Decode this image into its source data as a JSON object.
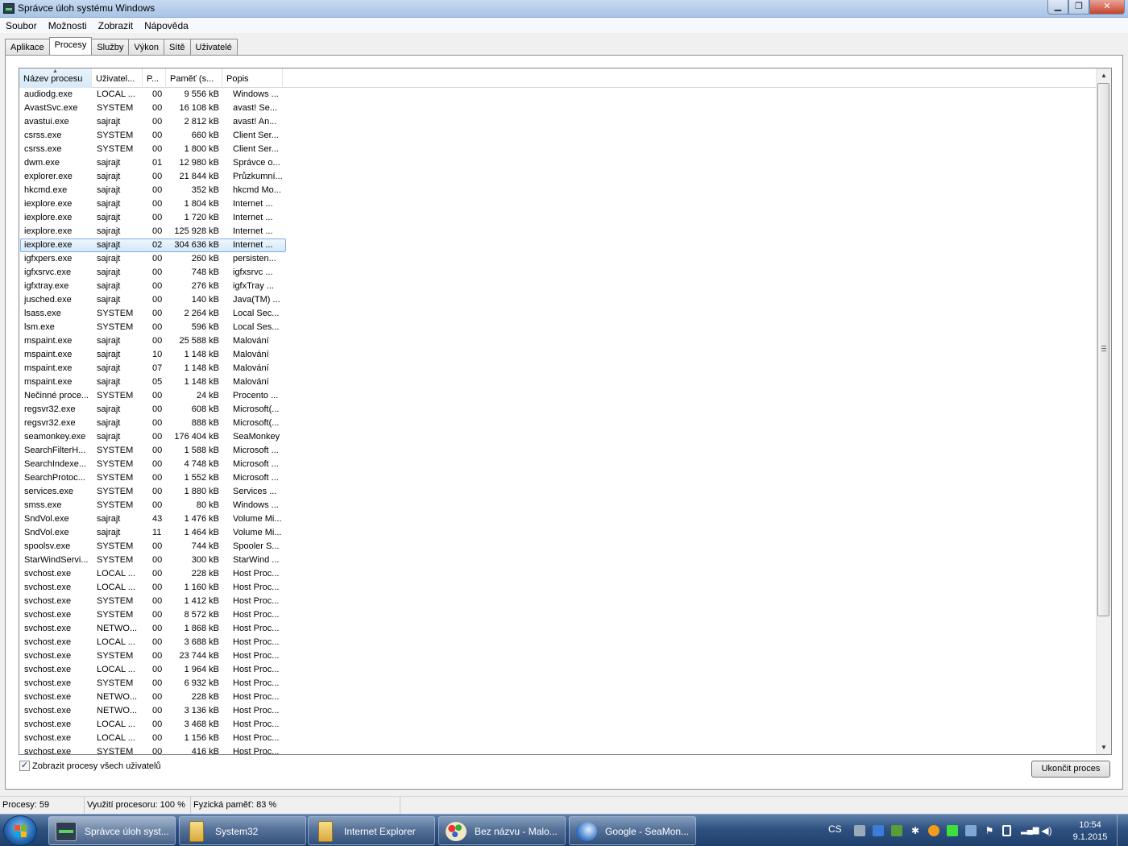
{
  "window": {
    "title": "Správce úloh systému Windows"
  },
  "menu": [
    "Soubor",
    "Možnosti",
    "Zobrazit",
    "Nápověda"
  ],
  "tabs": [
    "Aplikace",
    "Procesy",
    "Služby",
    "Výkon",
    "Sítě",
    "Uživatelé"
  ],
  "active_tab": "Procesy",
  "columns": [
    "Název procesu",
    "Uživatel...",
    "P...",
    "Paměť (s...",
    "Popis"
  ],
  "processes": [
    [
      "audiodg.exe",
      "LOCAL ...",
      "00",
      "9 556 kB",
      "Windows ..."
    ],
    [
      "AvastSvc.exe",
      "SYSTEM",
      "00",
      "16 108 kB",
      "avast! Se..."
    ],
    [
      "avastui.exe",
      "sajrajt",
      "00",
      "2 812 kB",
      "avast! An..."
    ],
    [
      "csrss.exe",
      "SYSTEM",
      "00",
      "660 kB",
      "Client Ser..."
    ],
    [
      "csrss.exe",
      "SYSTEM",
      "00",
      "1 800 kB",
      "Client Ser..."
    ],
    [
      "dwm.exe",
      "sajrajt",
      "01",
      "12 980 kB",
      "Správce o..."
    ],
    [
      "explorer.exe",
      "sajrajt",
      "00",
      "21 844 kB",
      "Průzkumní..."
    ],
    [
      "hkcmd.exe",
      "sajrajt",
      "00",
      "352 kB",
      "hkcmd Mo..."
    ],
    [
      "iexplore.exe",
      "sajrajt",
      "00",
      "1 804 kB",
      "Internet ..."
    ],
    [
      "iexplore.exe",
      "sajrajt",
      "00",
      "1 720 kB",
      "Internet ..."
    ],
    [
      "iexplore.exe",
      "sajrajt",
      "00",
      "125 928 kB",
      "Internet ..."
    ],
    [
      "iexplore.exe",
      "sajrajt",
      "02",
      "304 636 kB",
      "Internet ..."
    ],
    [
      "igfxpers.exe",
      "sajrajt",
      "00",
      "260 kB",
      "persisten..."
    ],
    [
      "igfxsrvc.exe",
      "sajrajt",
      "00",
      "748 kB",
      "igfxsrvc ..."
    ],
    [
      "igfxtray.exe",
      "sajrajt",
      "00",
      "276 kB",
      "igfxTray ..."
    ],
    [
      "jusched.exe",
      "sajrajt",
      "00",
      "140 kB",
      "Java(TM) ..."
    ],
    [
      "lsass.exe",
      "SYSTEM",
      "00",
      "2 264 kB",
      "Local Sec..."
    ],
    [
      "lsm.exe",
      "SYSTEM",
      "00",
      "596 kB",
      "Local Ses..."
    ],
    [
      "mspaint.exe",
      "sajrajt",
      "00",
      "25 588 kB",
      "Malování"
    ],
    [
      "mspaint.exe",
      "sajrajt",
      "10",
      "1 148 kB",
      "Malování"
    ],
    [
      "mspaint.exe",
      "sajrajt",
      "07",
      "1 148 kB",
      "Malování"
    ],
    [
      "mspaint.exe",
      "sajrajt",
      "05",
      "1 148 kB",
      "Malování"
    ],
    [
      "Nečinné proce...",
      "SYSTEM",
      "00",
      "24 kB",
      "Procento ..."
    ],
    [
      "regsvr32.exe",
      "sajrajt",
      "00",
      "608 kB",
      "Microsoft(..."
    ],
    [
      "regsvr32.exe",
      "sajrajt",
      "00",
      "888 kB",
      "Microsoft(..."
    ],
    [
      "seamonkey.exe",
      "sajrajt",
      "00",
      "176 404 kB",
      "SeaMonkey"
    ],
    [
      "SearchFilterH...",
      "SYSTEM",
      "00",
      "1 588 kB",
      "Microsoft ..."
    ],
    [
      "SearchIndexe...",
      "SYSTEM",
      "00",
      "4 748 kB",
      "Microsoft ..."
    ],
    [
      "SearchProtoc...",
      "SYSTEM",
      "00",
      "1 552 kB",
      "Microsoft ..."
    ],
    [
      "services.exe",
      "SYSTEM",
      "00",
      "1 880 kB",
      "Services ..."
    ],
    [
      "smss.exe",
      "SYSTEM",
      "00",
      "80 kB",
      "Windows ..."
    ],
    [
      "SndVol.exe",
      "sajrajt",
      "43",
      "1 476 kB",
      "Volume Mi..."
    ],
    [
      "SndVol.exe",
      "sajrajt",
      "11",
      "1 464 kB",
      "Volume Mi..."
    ],
    [
      "spoolsv.exe",
      "SYSTEM",
      "00",
      "744 kB",
      "Spooler S..."
    ],
    [
      "StarWindServi...",
      "SYSTEM",
      "00",
      "300 kB",
      "StarWind ..."
    ],
    [
      "svchost.exe",
      "LOCAL ...",
      "00",
      "228 kB",
      "Host Proc..."
    ],
    [
      "svchost.exe",
      "LOCAL ...",
      "00",
      "1 160 kB",
      "Host Proc..."
    ],
    [
      "svchost.exe",
      "SYSTEM",
      "00",
      "1 412 kB",
      "Host Proc..."
    ],
    [
      "svchost.exe",
      "SYSTEM",
      "00",
      "8 572 kB",
      "Host Proc..."
    ],
    [
      "svchost.exe",
      "NETWO...",
      "00",
      "1 868 kB",
      "Host Proc..."
    ],
    [
      "svchost.exe",
      "LOCAL ...",
      "00",
      "3 688 kB",
      "Host Proc..."
    ],
    [
      "svchost.exe",
      "SYSTEM",
      "00",
      "23 744 kB",
      "Host Proc..."
    ],
    [
      "svchost.exe",
      "LOCAL ...",
      "00",
      "1 964 kB",
      "Host Proc..."
    ],
    [
      "svchost.exe",
      "SYSTEM",
      "00",
      "6 932 kB",
      "Host Proc..."
    ],
    [
      "svchost.exe",
      "NETWO...",
      "00",
      "228 kB",
      "Host Proc..."
    ],
    [
      "svchost.exe",
      "NETWO...",
      "00",
      "3 136 kB",
      "Host Proc..."
    ],
    [
      "svchost.exe",
      "LOCAL ...",
      "00",
      "3 468 kB",
      "Host Proc..."
    ],
    [
      "svchost.exe",
      "LOCAL ...",
      "00",
      "1 156 kB",
      "Host Proc..."
    ],
    [
      "svchost.exe",
      "SYSTEM",
      "00",
      "416 kB",
      "Host Proc..."
    ]
  ],
  "selected_row": 11,
  "show_all_users": {
    "label": "Zobrazit procesy všech uživatelů",
    "checked": true
  },
  "end_process_label": "Ukončit proces",
  "status": {
    "processes": "Procesy: 59",
    "cpu": "Využití procesoru: 100 %",
    "memory": "Fyzická paměť: 83 %"
  },
  "taskbar": {
    "items": [
      {
        "label": "Správce úloh syst...",
        "icon": "task-manager-icon",
        "active": true
      },
      {
        "label": "System32",
        "icon": "folder-icon",
        "active": false
      },
      {
        "label": "Internet Explorer",
        "icon": "folder-icon",
        "active": false
      },
      {
        "label": "Bez názvu - Malo...",
        "icon": "paint-icon",
        "active": false
      },
      {
        "label": "Google - SeaMon...",
        "icon": "seamonkey-icon",
        "active": false
      }
    ],
    "language": "CS",
    "time": "10:54",
    "date": "9.1.2015"
  }
}
